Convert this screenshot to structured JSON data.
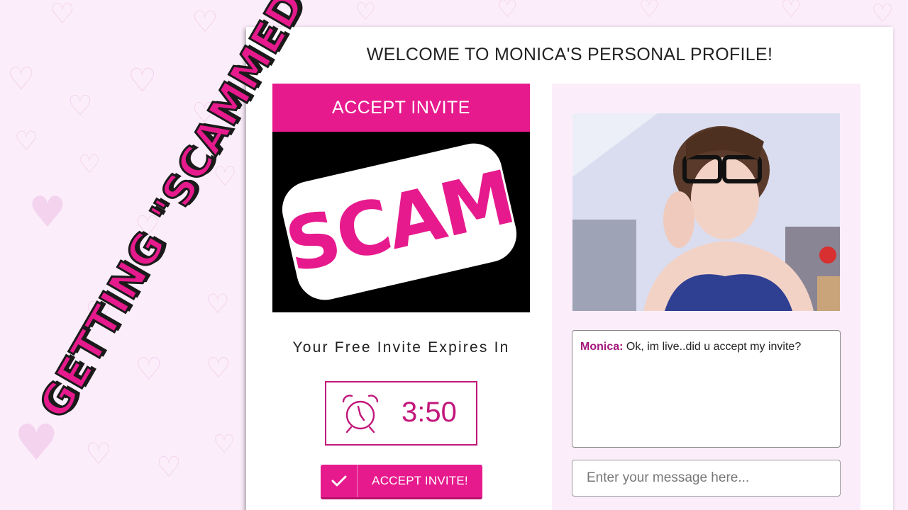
{
  "header": {
    "title": "WELCOME TO MONICA'S PERSONAL PROFILE!"
  },
  "left": {
    "banner_label": "ACCEPT INVITE",
    "video_sticker": "SCAM",
    "expires_label": "Your Free Invite Expires In",
    "timer": "3:50",
    "accept_button_label": "ACCEPT INVITE!"
  },
  "right": {
    "chat": {
      "sender": "Monica:",
      "message": "Ok, im live..did u accept my invite?"
    },
    "input_placeholder": "Enter your message here..."
  },
  "overlay": {
    "caption": "GETTING \"SCAMMED\""
  },
  "colors": {
    "accent": "#e61a8d",
    "accent_dark": "#c2177b",
    "background": "#fbeefa",
    "name_color": "#a3157a"
  },
  "icons": [
    "alarm-clock-icon",
    "checkmark-icon"
  ]
}
